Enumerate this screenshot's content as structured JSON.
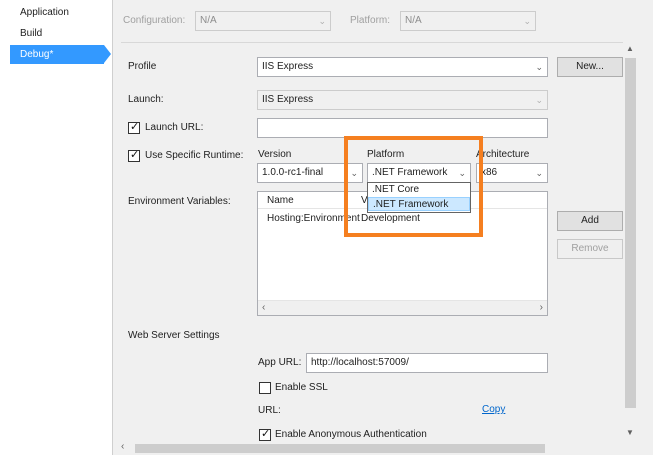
{
  "sidebar": {
    "items": [
      {
        "label": "Application"
      },
      {
        "label": "Build"
      },
      {
        "label": "Debug*"
      }
    ]
  },
  "header": {
    "configuration_label": "Configuration:",
    "configuration_value": "N/A",
    "platform_label": "Platform:",
    "platform_value": "N/A"
  },
  "profile": {
    "label": "Profile",
    "value": "IIS Express",
    "new_button": "New..."
  },
  "launch": {
    "label": "Launch:",
    "value": "IIS Express"
  },
  "launch_url": {
    "label": "Launch URL:",
    "value": ""
  },
  "runtime": {
    "label": "Use Specific Runtime:",
    "version_label": "Version",
    "version_value": "1.0.0-rc1-final",
    "platform_label": "Platform",
    "platform_value": ".NET Framework",
    "platform_options": [
      ".NET Core",
      ".NET Framework"
    ],
    "architecture_label": "Architecture",
    "architecture_value": "x86"
  },
  "env": {
    "label": "Environment Variables:",
    "col_name": "Name",
    "col_value": "V",
    "rows": [
      {
        "name": "Hosting:Environment",
        "value": "Development"
      }
    ],
    "add_button": "Add",
    "remove_button": "Remove"
  },
  "web_server": {
    "label": "Web Server Settings",
    "app_url_label": "App URL:",
    "app_url_value": "http://localhost:57009/",
    "enable_ssl_label": "Enable SSL",
    "url_label": "URL:",
    "copy_link": "Copy",
    "anon_auth_label": "Enable Anonymous Authentication"
  },
  "colors": {
    "accent": "#3399ff",
    "highlight": "#f57f20"
  }
}
